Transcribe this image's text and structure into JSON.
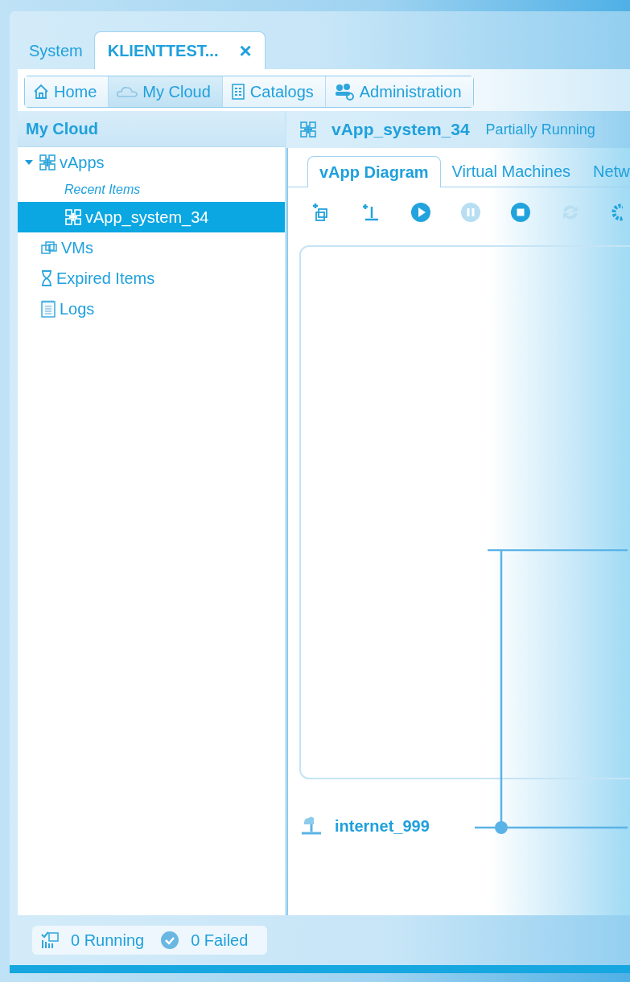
{
  "top_tabs": [
    {
      "label": "System",
      "selected": false,
      "closable": false
    },
    {
      "label": "KLIENTTEST...",
      "selected": true,
      "closable": true,
      "close": "×"
    }
  ],
  "nav": [
    {
      "kind": "home",
      "label": "Home",
      "selected": false
    },
    {
      "kind": "cloud",
      "label": "My Cloud",
      "selected": true
    },
    {
      "kind": "catalog",
      "label": "Catalogs",
      "selected": false
    },
    {
      "kind": "admin",
      "label": "Administration",
      "selected": false
    }
  ],
  "sidebar": {
    "title": "My Cloud",
    "items": [
      {
        "kind": "vapps",
        "label": "vApps",
        "expanded": true,
        "selected": false,
        "children": [
          {
            "kind": "heading",
            "label": "Recent Items",
            "selected": false
          },
          {
            "kind": "vapp",
            "label": "vApp_system_34",
            "selected": true
          }
        ]
      },
      {
        "kind": "vms",
        "label": "VMs",
        "selected": false
      },
      {
        "kind": "expired",
        "label": "Expired Items",
        "selected": false
      },
      {
        "kind": "logs",
        "label": "Logs",
        "selected": false
      }
    ]
  },
  "header": {
    "title": "vApp_system_34",
    "status": "Partially Running"
  },
  "tabs": [
    {
      "label": "vApp Diagram",
      "selected": true
    },
    {
      "label": "Virtual Machines",
      "selected": false
    },
    {
      "label": "Netw",
      "selected": false
    }
  ],
  "toolbar": [
    {
      "kind": "add-vm",
      "disabled": false
    },
    {
      "kind": "add-network",
      "disabled": false
    },
    {
      "kind": "start",
      "disabled": false
    },
    {
      "kind": "pause",
      "disabled": true
    },
    {
      "kind": "stop",
      "disabled": false
    },
    {
      "kind": "reset",
      "disabled": true
    },
    {
      "kind": "gear",
      "disabled": false
    }
  ],
  "network": {
    "name": "internet_999"
  },
  "status_bar": {
    "running": "0 Running",
    "failed": "0 Failed"
  }
}
